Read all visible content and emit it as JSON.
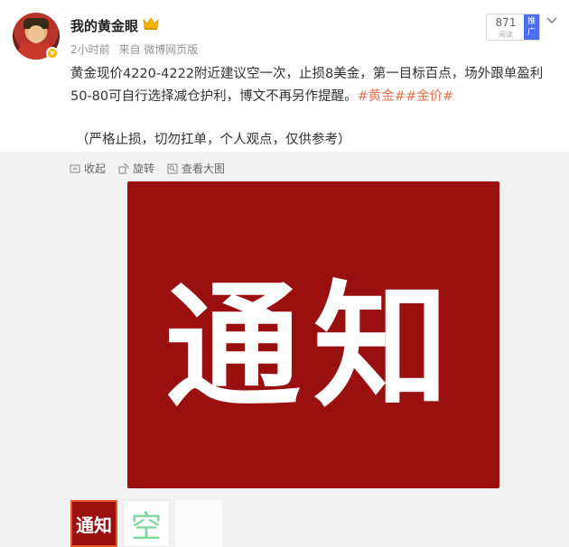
{
  "user": {
    "name": "我的黄金眼",
    "verified_badge": "v",
    "crown_icon": "crown-icon"
  },
  "meta": {
    "time": "2小时前",
    "source": "来自 微博网页版"
  },
  "stats": {
    "read_count": "871",
    "read_label": "阅读",
    "promo_label": "推广"
  },
  "post": {
    "text_part1": "黄金现价4220-4222附近建议空一次，止损8美金，第一目标百点，场外跟单盈利50-80可自行选择减仓护利，博文不再另作提醒。",
    "hashtag1": "#黄金#",
    "hashtag2": "#金价#",
    "note": "（严格止损，切勿扛单，个人观点，仅供参考）"
  },
  "toolbar": {
    "collect": "收起",
    "rotate": "旋转",
    "view_large": "查看大图"
  },
  "image": {
    "main_text": "通知",
    "thumb1_text": "通知",
    "thumb2_text": "空"
  },
  "colors": {
    "accent_hashtag": "#eb7350",
    "image_red": "#9a0f0f",
    "promo_blue": "#4e6ef2"
  }
}
